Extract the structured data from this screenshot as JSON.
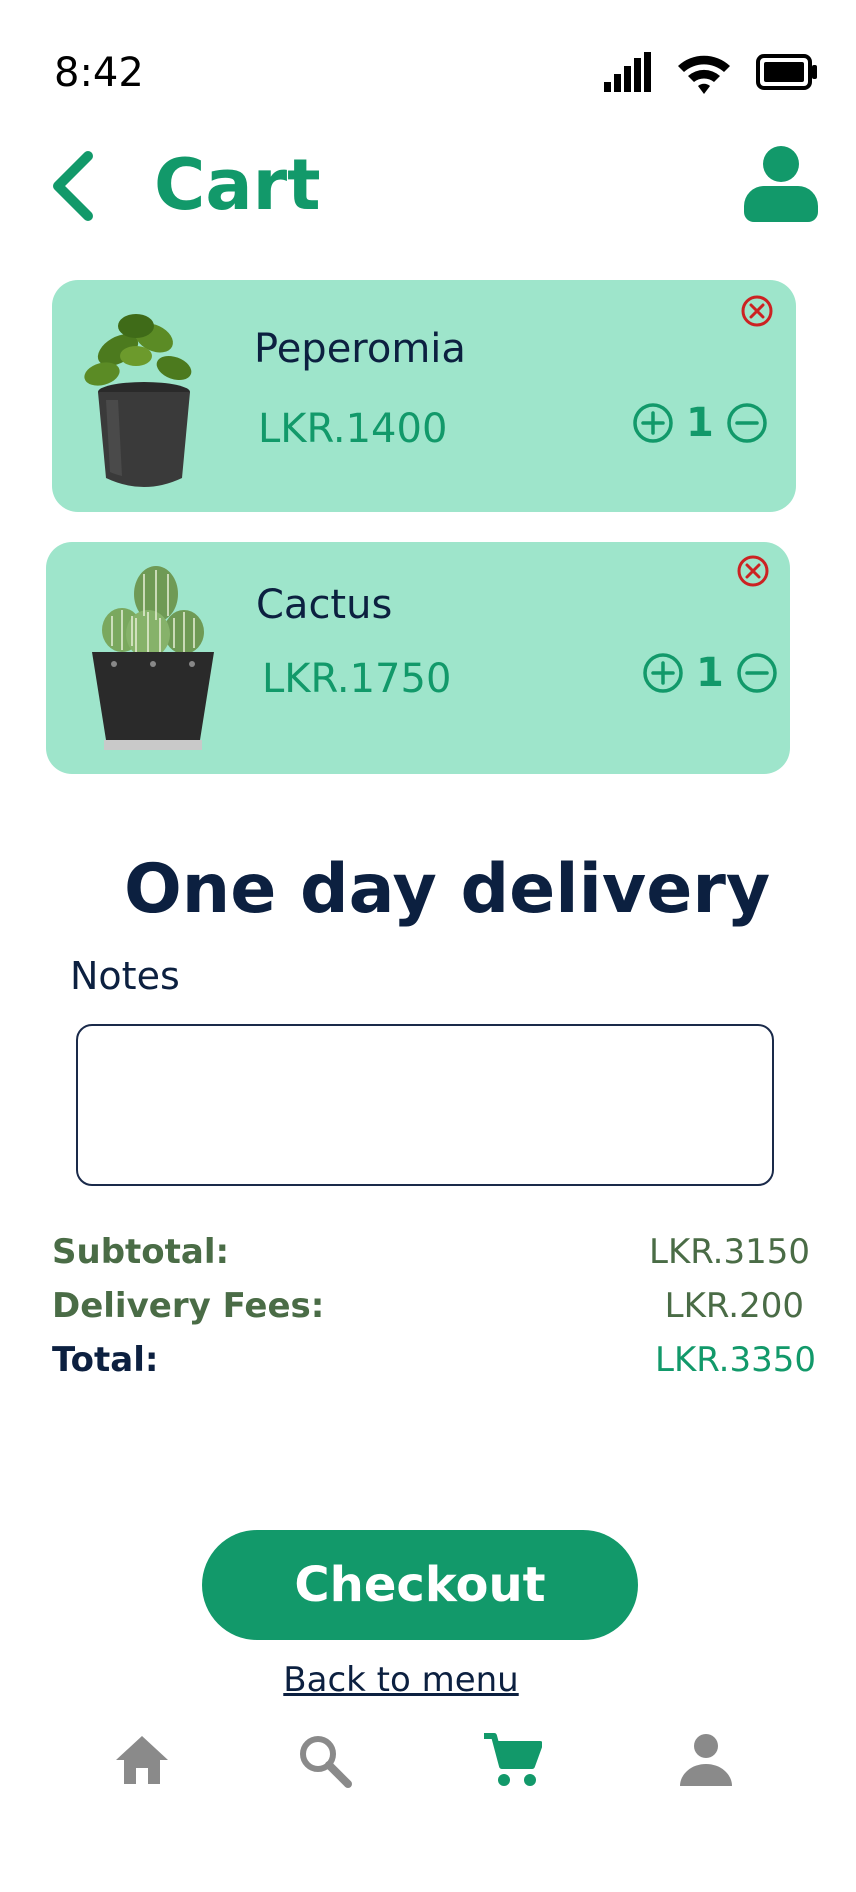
{
  "status_bar": {
    "time": "8:42"
  },
  "header": {
    "title": "Cart"
  },
  "cart_items": [
    {
      "name": "Peperomia",
      "price": "LKR.1400",
      "quantity": "1"
    },
    {
      "name": "Cactus",
      "price": "LKR.1750",
      "quantity": "1"
    }
  ],
  "delivery": {
    "heading": "One day delivery"
  },
  "notes": {
    "label": "Notes",
    "value": "",
    "placeholder": ""
  },
  "summary": {
    "subtotal_label": "Subtotal:",
    "subtotal_value": "LKR.3150",
    "delivery_label": "Delivery Fees:",
    "delivery_value": "LKR.200",
    "total_label": "Total:",
    "total_value": "LKR.3350"
  },
  "actions": {
    "checkout_label": "Checkout",
    "back_label": "Back to menu"
  },
  "bottom_nav": [
    {
      "icon": "home-icon",
      "active": false
    },
    {
      "icon": "search-icon",
      "active": false
    },
    {
      "icon": "cart-icon",
      "active": true
    },
    {
      "icon": "user-icon",
      "active": false
    }
  ],
  "colors": {
    "accent": "#12996a",
    "card": "#9ee5cb",
    "navy": "#0c2040",
    "remove": "#cc2222",
    "nav_inactive": "#8a8a8a"
  }
}
